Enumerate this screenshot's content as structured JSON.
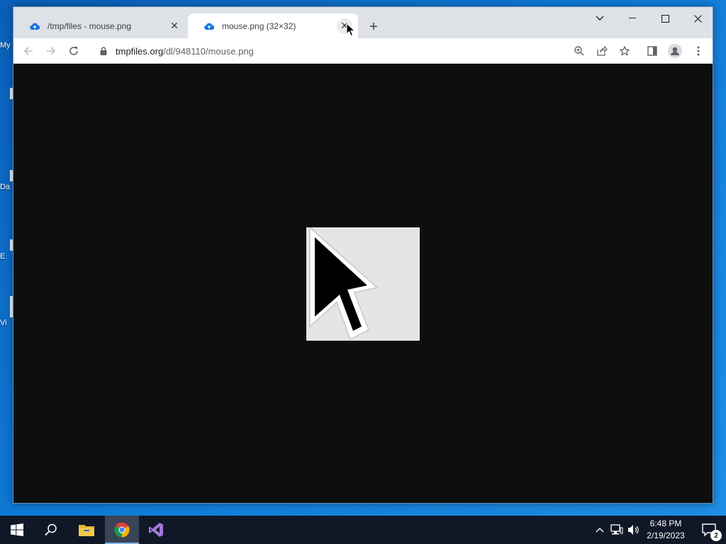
{
  "desktop": {
    "icons": [
      {
        "label": "My"
      },
      {
        "label": ""
      },
      {
        "label": "Da"
      },
      {
        "label": "E"
      },
      {
        "label": "Vi"
      }
    ]
  },
  "browser": {
    "tabs": [
      {
        "title": "/tmp/files - mouse.png",
        "icon": "cloud-upload-icon",
        "active": false
      },
      {
        "title": "mouse.png (32×32)",
        "icon": "cloud-upload-icon",
        "active": true
      }
    ],
    "address": {
      "host": "tmpfiles.org",
      "path": "/dl/948110/mouse.png"
    },
    "accent_color": "#1a73e8"
  },
  "taskbar": {
    "time": "6:48 PM",
    "date": "2/19/2023",
    "notification_count": "2",
    "apps": [
      "start-icon",
      "search-icon",
      "file-explorer-icon",
      "chrome-icon",
      "visual-studio-icon"
    ]
  }
}
